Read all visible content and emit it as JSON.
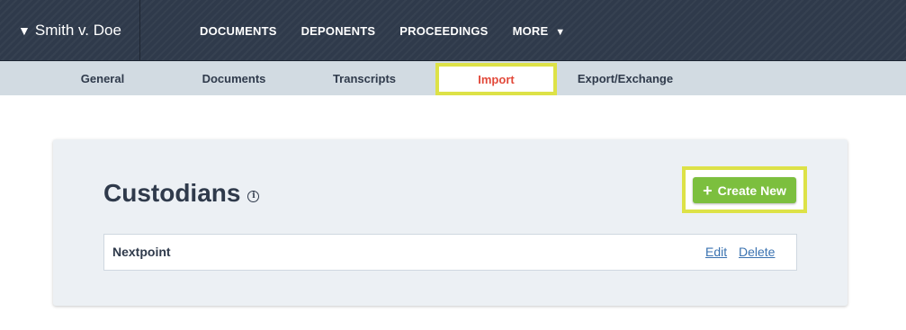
{
  "header": {
    "case_name": "Smith v. Doe",
    "case_caret": "▼",
    "nav": [
      {
        "label": "DOCUMENTS"
      },
      {
        "label": "DEPONENTS"
      },
      {
        "label": "PROCEEDINGS"
      },
      {
        "label": "MORE",
        "caret": "▼"
      }
    ]
  },
  "subnav": {
    "tabs": [
      {
        "label": "General"
      },
      {
        "label": "Documents"
      },
      {
        "label": "Transcripts"
      },
      {
        "label": "Import",
        "active": true
      },
      {
        "label": "Export/Exchange"
      }
    ]
  },
  "custodians": {
    "title": "Custodians",
    "info_icon": "i",
    "create_button": {
      "icon": "+",
      "label": "Create New"
    },
    "rows": [
      {
        "name": "Nextpoint",
        "edit_label": "Edit",
        "delete_label": "Delete"
      }
    ]
  },
  "colors": {
    "header_bg": "#2f3a4b",
    "subnav_bg": "#d2dbe2",
    "highlight": "#dde247",
    "active_tab_text": "#e2493a",
    "create_button_bg": "#7cbf3e",
    "link": "#3a72b0"
  }
}
